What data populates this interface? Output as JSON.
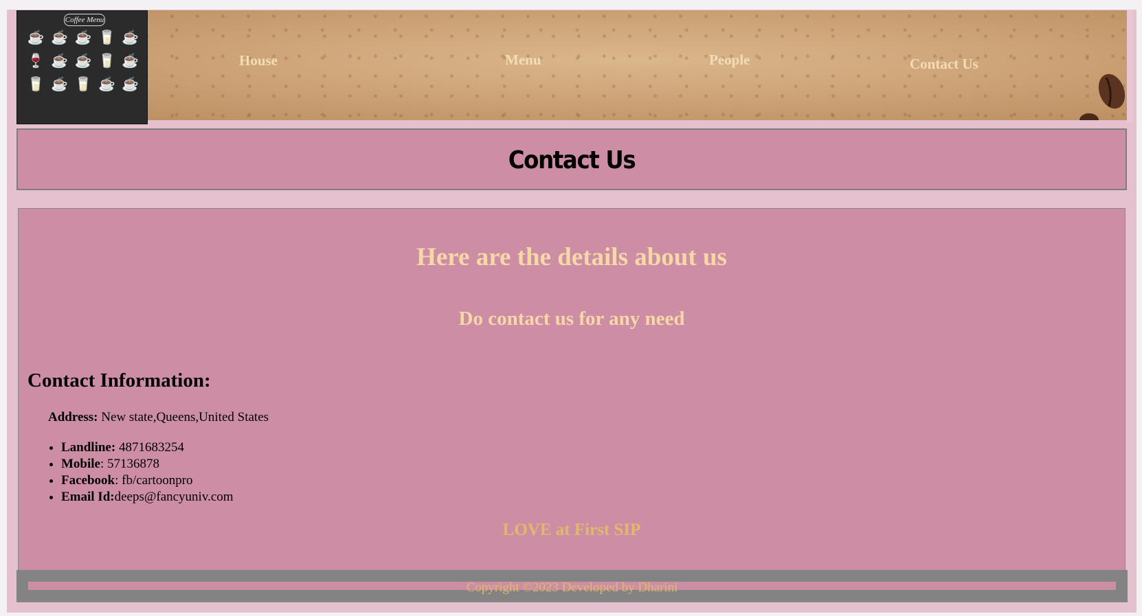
{
  "header": {
    "logo": {
      "title": "Coffee Menu"
    },
    "nav": [
      "House",
      "Menu",
      "People",
      "Contact Us"
    ]
  },
  "page_title": "Contact Us",
  "main": {
    "heading": "Here are the details about us",
    "subheading": "Do contact us for any need",
    "info_title": "Contact Information:",
    "address": {
      "label": "Address:",
      "value": " New state,Queens,United States"
    },
    "contacts": [
      {
        "label": "Landline:",
        "value": " 4871683254"
      },
      {
        "label": "Mobile",
        "value": ": 57136878"
      },
      {
        "label": "Facebook",
        "value": ": fb/cartoonpro"
      },
      {
        "label": "Email Id:",
        "value": "deeps@fancyuniv.com"
      }
    ],
    "tagline": "LOVE at First SIP"
  },
  "footer": {
    "copyright": "Copyright ©2023 Developed by Dharini"
  },
  "colors": {
    "page_bg": "#e5c1cf",
    "panel_pink": "#cd8ea5",
    "cream_text": "#f6d7a8",
    "gold_text": "#e2b86a",
    "footer_gray": "#838383"
  }
}
